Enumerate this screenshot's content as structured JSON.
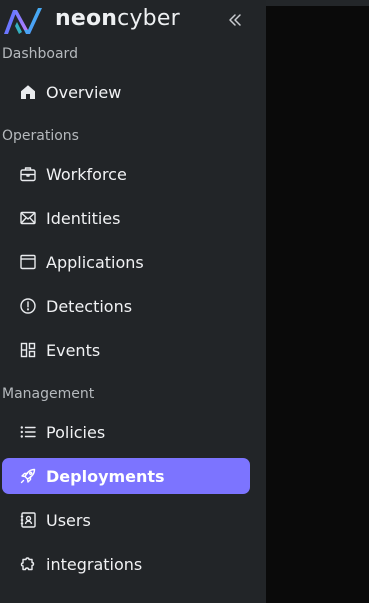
{
  "brand": {
    "name_bold": "neon",
    "name_light": "cyber"
  },
  "sections": {
    "dashboard": "Dashboard",
    "operations": "Operations",
    "management": "Management"
  },
  "nav": {
    "overview": "Overview",
    "workforce": "Workforce",
    "identities": "Identities",
    "applications": "Applications",
    "detections": "Detections",
    "events": "Events",
    "policies": "Policies",
    "deployments": "Deployments",
    "users": "Users",
    "integrations": "integrations"
  },
  "active_item": "deployments",
  "colors": {
    "sidebar_bg": "#222528",
    "main_bg": "#0a0a0a",
    "accent": "#7c74ff",
    "text": "#f1f2f4",
    "section_text": "#b5b9bd"
  },
  "icons": {
    "overview": "home-icon",
    "workforce": "briefcase-icon",
    "identities": "envelope-icon",
    "applications": "window-icon",
    "detections": "alert-circle-icon",
    "events": "layout-grid-icon",
    "policies": "list-icon",
    "deployments": "rocket-icon",
    "users": "contact-book-icon",
    "integrations": "puzzle-icon",
    "collapse": "chevrons-left-icon"
  }
}
